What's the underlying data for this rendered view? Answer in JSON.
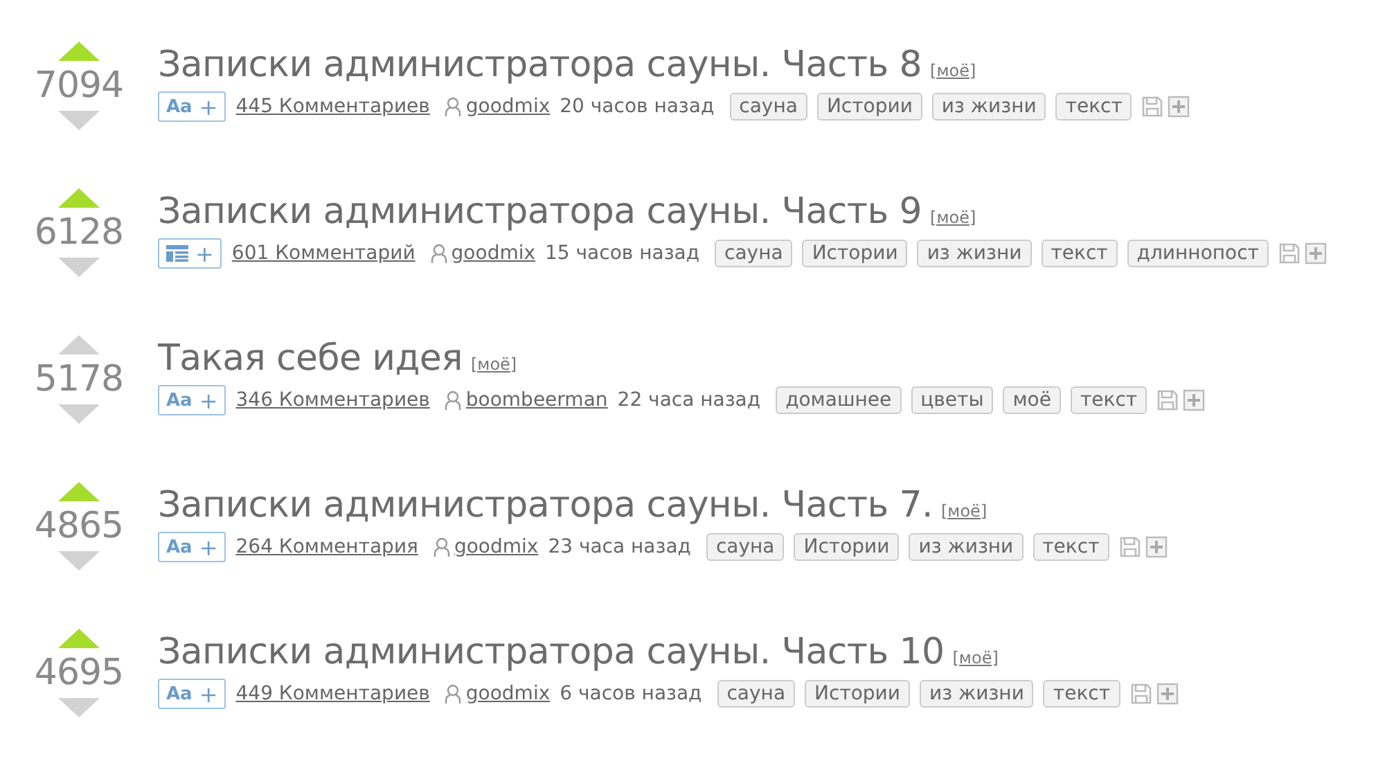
{
  "posts": [
    {
      "score": "7094",
      "upvoted": true,
      "title": "Записки администратора сауны. Часть 8",
      "mine": "[моё]",
      "badge": {
        "kind": "text",
        "label": "Aa",
        "plus": "+"
      },
      "comments": "445 Комментариев",
      "author": "goodmix",
      "time": "20 часов назад",
      "tags": [
        "сауна",
        "Истории",
        "из жизни",
        "текст"
      ]
    },
    {
      "score": "6128",
      "upvoted": true,
      "title": "Записки администратора сауны. Часть 9",
      "mine": "[моё]",
      "badge": {
        "kind": "list",
        "plus": "+"
      },
      "comments": "601 Комментарий",
      "author": "goodmix",
      "time": "15 часов назад",
      "tags": [
        "сауна",
        "Истории",
        "из жизни",
        "текст",
        "длиннопост"
      ]
    },
    {
      "score": "5178",
      "upvoted": false,
      "title": "Такая себе идея",
      "mine": "[моё]",
      "badge": {
        "kind": "text",
        "label": "Aa",
        "plus": "+"
      },
      "comments": "346 Комментариев",
      "author": "boombeerman",
      "time": "22 часа назад",
      "tags": [
        "домашнее",
        "цветы",
        "моё",
        "текст"
      ]
    },
    {
      "score": "4865",
      "upvoted": true,
      "title": "Записки администратора сауны. Часть 7.",
      "mine": "[моё]",
      "badge": {
        "kind": "text",
        "label": "Aa",
        "plus": "+"
      },
      "comments": "264 Комментария",
      "author": "goodmix",
      "time": "23 часа назад",
      "tags": [
        "сауна",
        "Истории",
        "из жизни",
        "текст"
      ]
    },
    {
      "score": "4695",
      "upvoted": true,
      "title": "Записки администратора сауны. Часть 10",
      "mine": "[моё]",
      "badge": {
        "kind": "text",
        "label": "Aa",
        "plus": "+"
      },
      "comments": "449 Комментариев",
      "author": "goodmix",
      "time": "6 часов назад",
      "tags": [
        "сауна",
        "Истории",
        "из жизни",
        "текст"
      ]
    }
  ]
}
